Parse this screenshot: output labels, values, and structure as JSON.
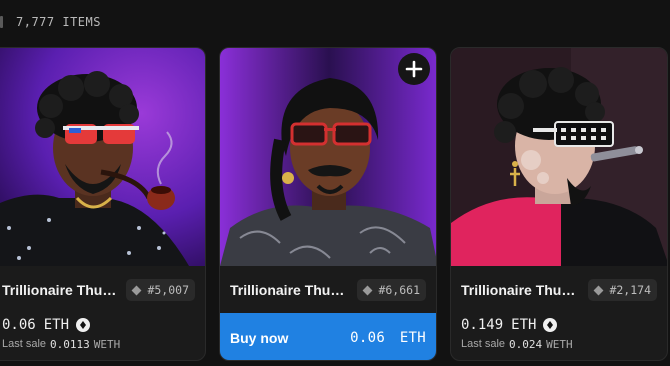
{
  "header": {
    "items_count": "7,777 ITEMS"
  },
  "colors": {
    "accent": "#2081e2",
    "background": "#121212",
    "card": "#1b1b1b"
  },
  "cards": [
    {
      "name": "Trillionaire Thu…",
      "token": "#5,007",
      "price": "0.06",
      "currency": "ETH",
      "last_sale_label": "Last sale",
      "last_sale_value": "0.0113",
      "last_sale_currency": "WETH",
      "background_colors": [
        "#5a1fb0",
        "#8a2bd0"
      ],
      "accessories": "red-shades, pipe, silver-chain"
    },
    {
      "name": "Trillionaire Thu…",
      "token": "#6,661",
      "price": "0.06",
      "currency": "ETH",
      "buy_label": "Buy now",
      "add_icon": "plus-icon",
      "background_colors": [
        "#3a1878",
        "#8a2fd8"
      ],
      "accessories": "red-shades, gold-earring"
    },
    {
      "name": "Trillionaire Thu…",
      "token": "#2,174",
      "price": "0.149",
      "currency": "ETH",
      "last_sale_label": "Last sale",
      "last_sale_value": "0.024",
      "last_sale_currency": "WETH",
      "background_colors": [
        "#2a1620",
        "#4a2a35"
      ],
      "accessories": "led-shades, cigar, cross-earring"
    }
  ]
}
